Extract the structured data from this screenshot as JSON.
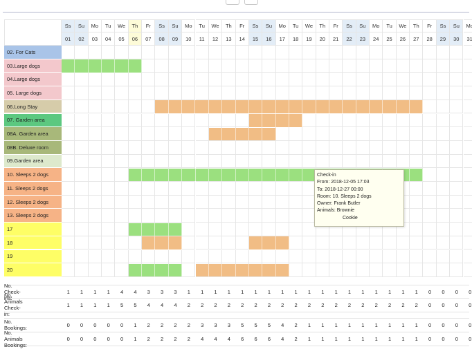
{
  "days": [
    {
      "dow": "Ss",
      "day": "01",
      "weekend": true
    },
    {
      "dow": "Su",
      "day": "02",
      "weekend": true
    },
    {
      "dow": "Mo",
      "day": "03"
    },
    {
      "dow": "Tu",
      "day": "04"
    },
    {
      "dow": "We",
      "day": "05"
    },
    {
      "dow": "Th",
      "day": "06",
      "today": true
    },
    {
      "dow": "Fr",
      "day": "07"
    },
    {
      "dow": "Ss",
      "day": "08",
      "weekend": true
    },
    {
      "dow": "Su",
      "day": "09",
      "weekend": true
    },
    {
      "dow": "Mo",
      "day": "10"
    },
    {
      "dow": "Tu",
      "day": "11"
    },
    {
      "dow": "We",
      "day": "12"
    },
    {
      "dow": "Th",
      "day": "13"
    },
    {
      "dow": "Fr",
      "day": "14"
    },
    {
      "dow": "Ss",
      "day": "15",
      "weekend": true
    },
    {
      "dow": "Su",
      "day": "16",
      "weekend": true
    },
    {
      "dow": "Mo",
      "day": "17"
    },
    {
      "dow": "Tu",
      "day": "18"
    },
    {
      "dow": "We",
      "day": "19"
    },
    {
      "dow": "Th",
      "day": "20"
    },
    {
      "dow": "Fr",
      "day": "21"
    },
    {
      "dow": "Ss",
      "day": "22",
      "weekend": true
    },
    {
      "dow": "Su",
      "day": "23",
      "weekend": true
    },
    {
      "dow": "Mo",
      "day": "24"
    },
    {
      "dow": "Tu",
      "day": "25"
    },
    {
      "dow": "We",
      "day": "26"
    },
    {
      "dow": "Th",
      "day": "27"
    },
    {
      "dow": "Fr",
      "day": "28"
    },
    {
      "dow": "Ss",
      "day": "29",
      "weekend": true
    },
    {
      "dow": "Su",
      "day": "30",
      "weekend": true
    },
    {
      "dow": "Mo",
      "day": "31"
    }
  ],
  "rooms": [
    {
      "label": "02. For Cats",
      "color": "#a9c4e8"
    },
    {
      "label": "03.Large dogs",
      "color": "#f3c8cc"
    },
    {
      "label": "04.Large dogs",
      "color": "#f3c8cc"
    },
    {
      "label": "05. Large dogs",
      "color": "#f3c8cc"
    },
    {
      "label": "06.Long Stay",
      "color": "#d6ccaa"
    },
    {
      "label": "07. Garden area",
      "color": "#5cc880"
    },
    {
      "label": "08A. Garden area",
      "color": "#a8b87a"
    },
    {
      "label": "08B. Deluxe room",
      "color": "#a8b87a"
    },
    {
      "label": "09.Garden area",
      "color": "#dde9cc"
    },
    {
      "label": "10. Sleeps 2 dogs",
      "color": "#f6b386"
    },
    {
      "label": "11. Sleeps 2 dogs",
      "color": "#f6b386"
    },
    {
      "label": "12. Sleeps 2 dogs",
      "color": "#f6b386"
    },
    {
      "label": "13. Sleeps 2 dogs",
      "color": "#f6b386"
    },
    {
      "label": "17",
      "color": "#fefe66"
    },
    {
      "label": "18",
      "color": "#fefe66"
    },
    {
      "label": "19",
      "color": "#fefe66"
    },
    {
      "label": "20",
      "color": "#fefe66"
    }
  ],
  "status_colors": {
    "checked_in": "#9be07f",
    "booked": "#f1bd85"
  },
  "bookings": [
    {
      "room": 1,
      "start": 0,
      "end": 5,
      "status": "checked_in"
    },
    {
      "room": 4,
      "start": 7,
      "end": 26,
      "status": "booked"
    },
    {
      "room": 5,
      "start": 14,
      "end": 17,
      "status": "booked"
    },
    {
      "room": 6,
      "start": 11,
      "end": 15,
      "status": "booked"
    },
    {
      "room": 9,
      "start": 5,
      "end": 26,
      "status": "checked_in"
    },
    {
      "room": 13,
      "start": 5,
      "end": 8,
      "status": "checked_in"
    },
    {
      "room": 14,
      "start": 6,
      "end": 8,
      "status": "booked"
    },
    {
      "room": 14,
      "start": 14,
      "end": 16,
      "status": "booked"
    },
    {
      "room": 16,
      "start": 5,
      "end": 8,
      "status": "checked_in"
    },
    {
      "room": 16,
      "start": 10,
      "end": 16,
      "status": "booked"
    }
  ],
  "tooltip": {
    "title": "Check-in",
    "from": "From: 2018-12-05 17:03",
    "to": "To: 2018-12-27 00:00",
    "room": "Room: 10. Sleeps 2 dogs",
    "owner": "Owner: Frank Butler",
    "animals": "Animals: Brownie",
    "animal2": "Cookie"
  },
  "stats": [
    {
      "label": "No. Check-ins:",
      "values": [
        1,
        1,
        1,
        1,
        4,
        4,
        3,
        3,
        3,
        1,
        1,
        1,
        1,
        1,
        1,
        1,
        1,
        1,
        1,
        1,
        1,
        1,
        1,
        1,
        1,
        1,
        1,
        0,
        0,
        0,
        0
      ]
    },
    {
      "label": "No. Animals Check-in:",
      "values": [
        1,
        1,
        1,
        1,
        5,
        5,
        4,
        4,
        4,
        2,
        2,
        2,
        2,
        2,
        2,
        2,
        2,
        2,
        2,
        2,
        2,
        2,
        2,
        2,
        2,
        2,
        2,
        0,
        0,
        0,
        0
      ]
    },
    {
      "label": "No. Bookings:",
      "values": [
        0,
        0,
        0,
        0,
        0,
        1,
        2,
        2,
        2,
        2,
        3,
        3,
        3,
        5,
        5,
        5,
        4,
        2,
        1,
        1,
        1,
        1,
        1,
        1,
        1,
        1,
        1,
        0,
        0,
        0,
        0
      ]
    },
    {
      "label": "No. Animals Bookings:",
      "values": [
        0,
        0,
        0,
        0,
        0,
        1,
        2,
        2,
        2,
        2,
        4,
        4,
        4,
        6,
        6,
        6,
        4,
        2,
        1,
        1,
        1,
        1,
        1,
        1,
        1,
        1,
        1,
        0,
        0,
        0,
        0
      ]
    }
  ]
}
